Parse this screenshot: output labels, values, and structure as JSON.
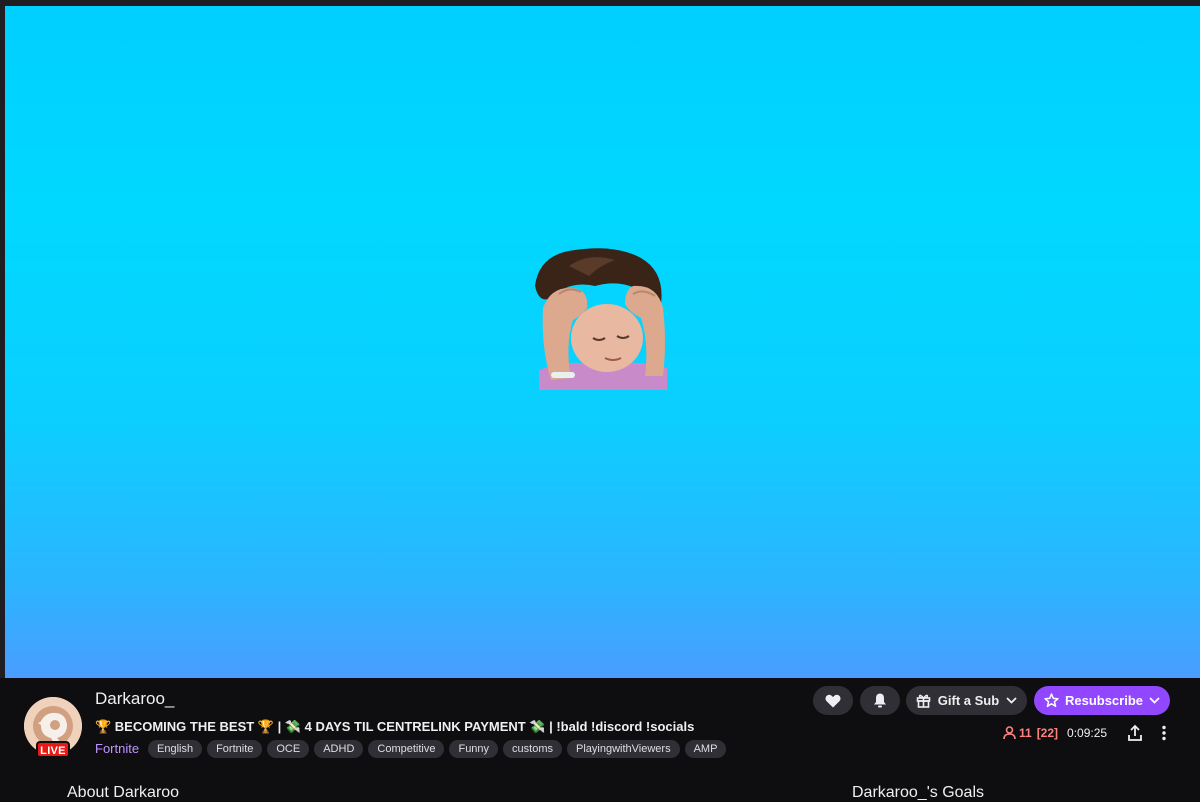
{
  "channel": {
    "name": "Darkaroo_",
    "live_badge": "LIVE",
    "stream_title": "🏆 BECOMING THE BEST 🏆 | 💸 4 DAYS TIL CENTRELINK PAYMENT 💸 | !bald !discord !socials",
    "category": "Fortnite",
    "tags": [
      "English",
      "Fortnite",
      "OCE",
      "ADHD",
      "Competitive",
      "Funny",
      "customs",
      "PlayingwithViewers",
      "AMP"
    ]
  },
  "actions": {
    "follow_icon": "heart-icon",
    "notify_icon": "bell-icon",
    "gift_label": "Gift a Sub",
    "resub_label": "Resubscribe"
  },
  "stats": {
    "viewers": "11",
    "viewers_extra": "[22]",
    "uptime": "0:09:25"
  },
  "sections": {
    "about": "About Darkaroo",
    "goals": "Darkaroo_'s Goals"
  },
  "colors": {
    "accent": "#9147ff",
    "live": "#e91916",
    "category": "#bf94ff",
    "viewer": "#ff8280",
    "player_bg_top": "#00cfff",
    "player_bg_bottom": "#4a9dff"
  }
}
